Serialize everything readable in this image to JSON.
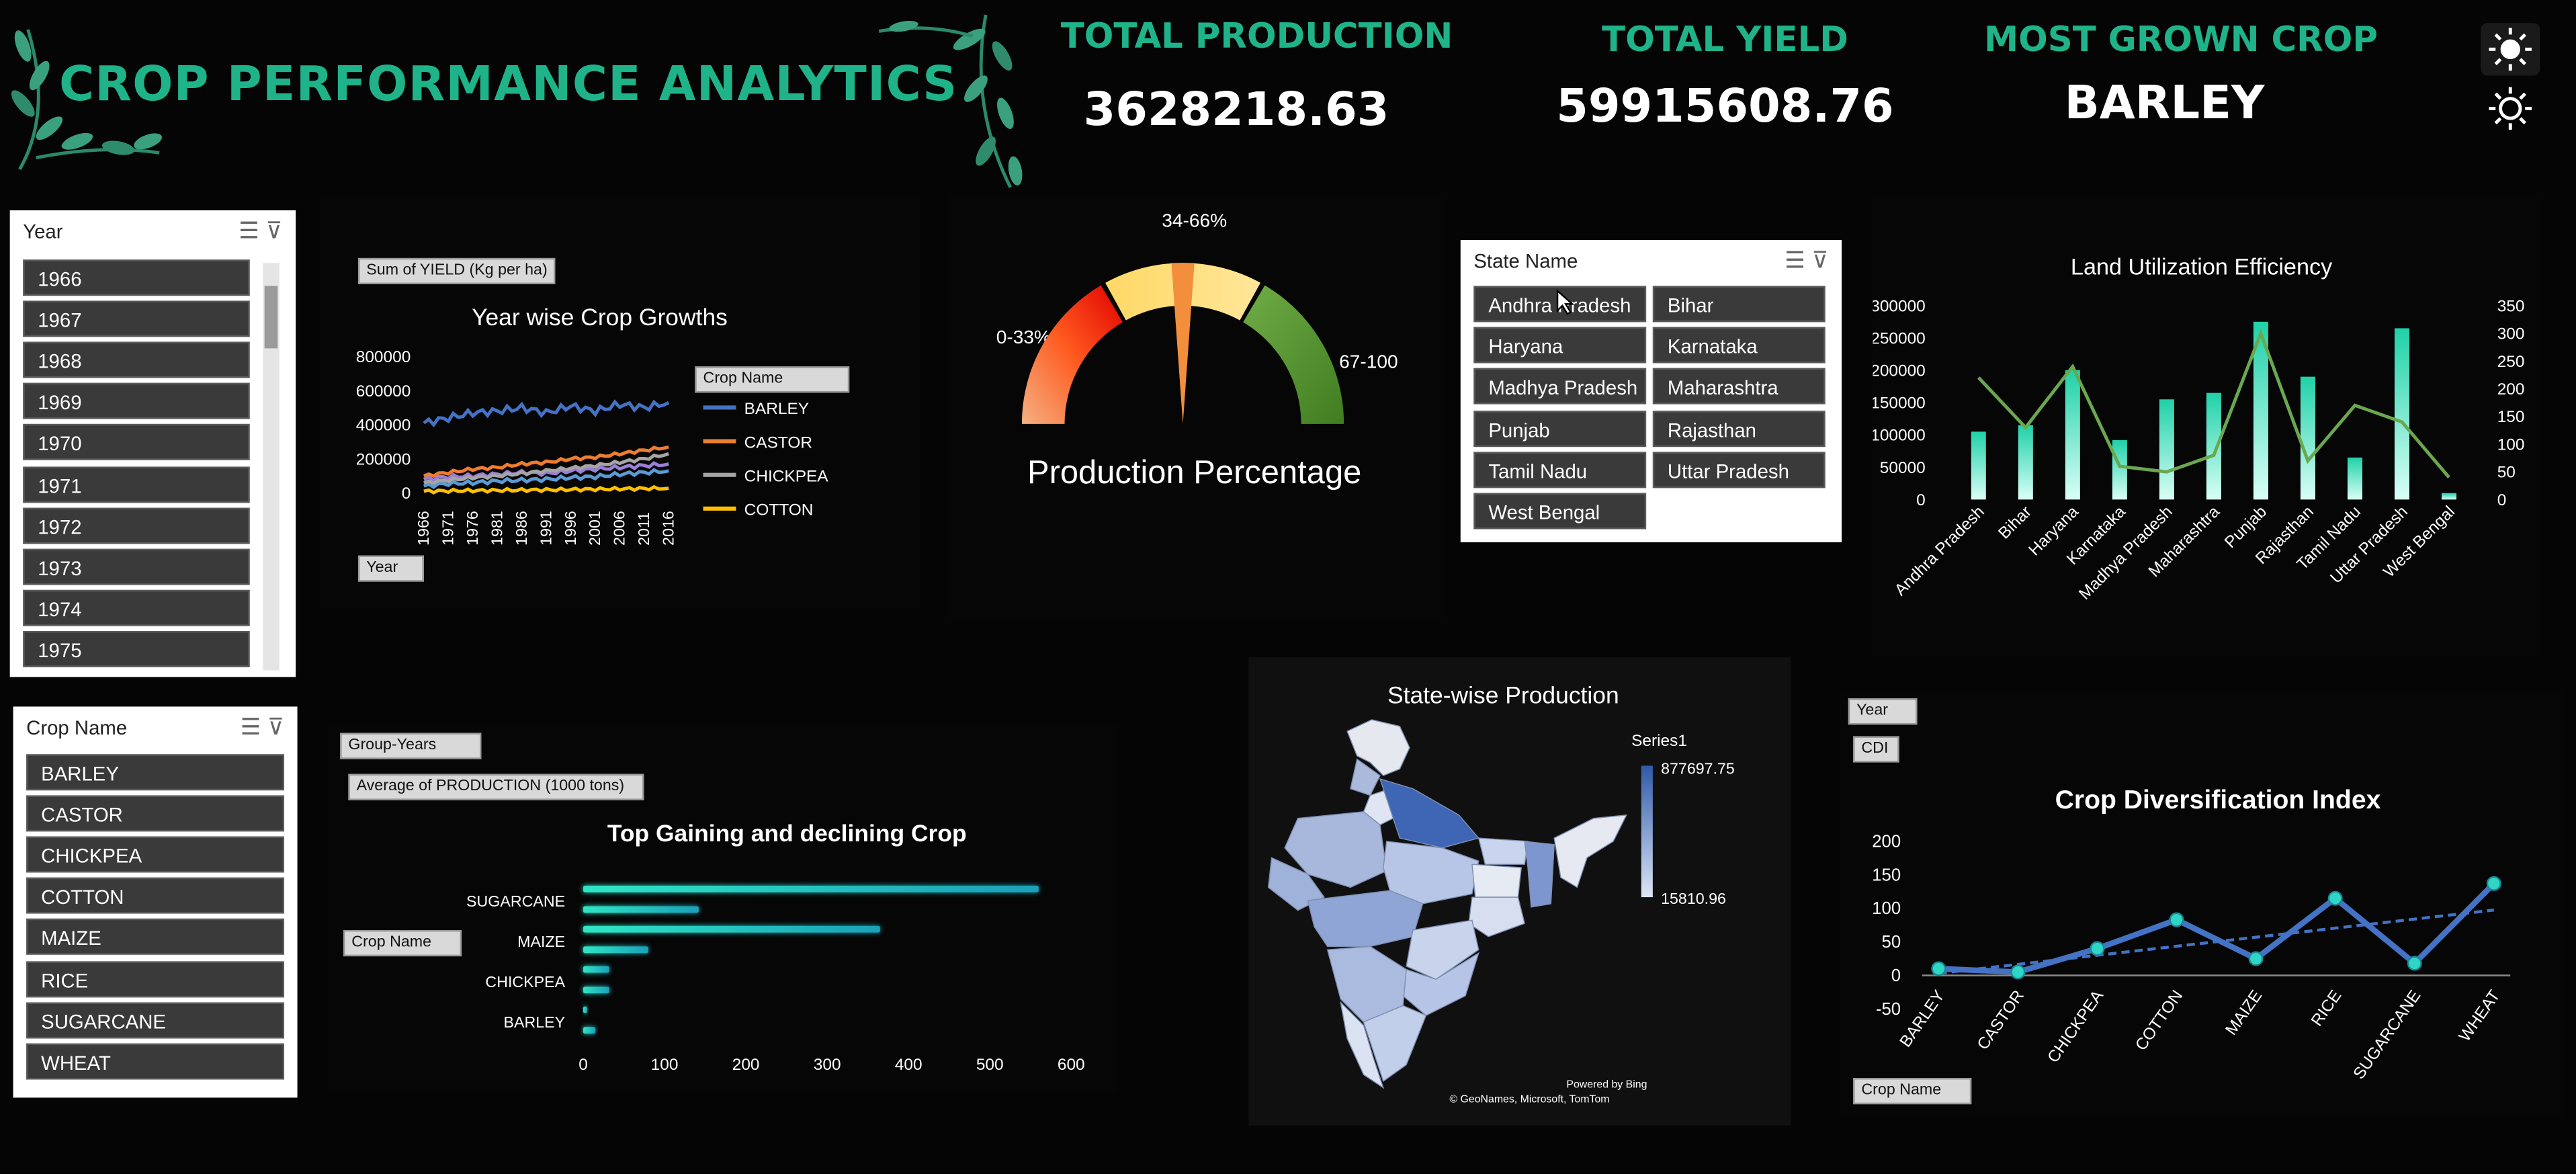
{
  "header": {
    "title": "CROP PERFORMANCE ANALYTICS",
    "kpis": [
      {
        "label": "TOTAL PRODUCTION",
        "value": "3628218.63"
      },
      {
        "label": "TOTAL YIELD",
        "value": "59915608.76"
      },
      {
        "label": "MOST GROWN CROP",
        "value": "BARLEY"
      }
    ]
  },
  "year_slicer": {
    "title": "Year",
    "items": [
      "1966",
      "1967",
      "1968",
      "1969",
      "1970",
      "1971",
      "1972",
      "1973",
      "1974",
      "1975"
    ]
  },
  "crop_slicer": {
    "title": "Crop Name",
    "items": [
      "BARLEY",
      "CASTOR",
      "CHICKPEA",
      "COTTON",
      "MAIZE",
      "RICE",
      "SUGARCANE",
      "WHEAT"
    ]
  },
  "state_slicer": {
    "title": "State Name",
    "items": [
      "Andhra Pradesh",
      "Bihar",
      "Haryana",
      "Karnataka",
      "Madhya Pradesh",
      "Maharashtra",
      "Punjab",
      "Rajasthan",
      "Tamil Nadu",
      "Uttar Pradesh",
      "West Bengal"
    ]
  },
  "pivot_buttons": {
    "yield_field": "Sum of YIELD (Kg per ha)",
    "crop_name": "Crop Name",
    "year": "Year",
    "group_years": "Group-Years",
    "avg_production": "Average of PRODUCTION (1000 tons)",
    "crop_name2": "Crop Name",
    "year2": "Year",
    "cdi": "CDI",
    "crop_name3": "Crop Name"
  },
  "map": {
    "powered_by": "Powered by Bing",
    "attribution": "© GeoNames, Microsoft, TomTom"
  },
  "chart_data": [
    {
      "type": "line",
      "title": "Year wise  Crop Growths",
      "x": [
        1966,
        1971,
        1976,
        1981,
        1986,
        1991,
        1996,
        2001,
        2006,
        2011,
        2016
      ],
      "ylim": [
        0,
        800000
      ],
      "yticks": [
        "800000",
        "600000",
        "400000",
        "200000",
        "0"
      ],
      "xticks": [
        "1966",
        "1971",
        "1976",
        "1981",
        "1986",
        "1991",
        "1996",
        "2001",
        "2006",
        "2011",
        "2016"
      ],
      "legend_title": "Crop Name",
      "series": [
        {
          "name": "BARLEY",
          "color": "#4472c4",
          "values": [
            410000,
            440000,
            470000,
            480000,
            500000,
            470000,
            510000,
            480000,
            520000,
            500000,
            530000
          ]
        },
        {
          "name": "CASTOR",
          "color": "#ed7d31",
          "values": [
            100000,
            120000,
            140000,
            150000,
            170000,
            180000,
            200000,
            210000,
            230000,
            250000,
            270000
          ]
        },
        {
          "name": "CHICKPEA",
          "color": "#a5a5a5",
          "values": [
            60000,
            75000,
            90000,
            100000,
            115000,
            130000,
            145000,
            160000,
            180000,
            200000,
            230000
          ]
        },
        {
          "name": "COTTON",
          "color": "#ffc000",
          "values": [
            10000,
            12000,
            14000,
            15000,
            17000,
            18000,
            20000,
            22000,
            24000,
            26000,
            28000
          ]
        }
      ],
      "extra_lines": [
        {
          "color": "#9a7fd4",
          "values": [
            80000,
            95000,
            100000,
            110000,
            120000,
            115000,
            130000,
            140000,
            150000,
            160000,
            170000
          ]
        },
        {
          "color": "#5b9bd5",
          "values": [
            40000,
            55000,
            60000,
            70000,
            75000,
            80000,
            90000,
            95000,
            110000,
            120000,
            130000
          ]
        }
      ]
    },
    {
      "type": "gauge",
      "title": "Production Percentage",
      "bands": [
        {
          "label": "0-33%",
          "from": 0,
          "to": 33
        },
        {
          "label": "34-66%",
          "from": 34,
          "to": 66
        },
        {
          "label": "67-100",
          "from": 67,
          "to": 100
        }
      ],
      "needle_value": 50
    },
    {
      "type": "bar",
      "title": "Land Utilization Efficiency",
      "categories": [
        "Andhra Pradesh",
        "Bihar",
        "Haryana",
        "Karnataka",
        "Madhya Pradesh",
        "Maharashtra",
        "Punjab",
        "Rajasthan",
        "Tamil Nadu",
        "Uttar Pradesh",
        "West Bengal"
      ],
      "ylim": [
        0,
        300000
      ],
      "yticks": [
        "300000",
        "250000",
        "200000",
        "150000",
        "100000",
        "50000",
        "0"
      ],
      "y2lim": [
        0,
        350
      ],
      "y2ticks": [
        "350",
        "300",
        "250",
        "200",
        "150",
        "100",
        "50",
        "0"
      ],
      "bar_values": [
        105000,
        115000,
        200000,
        92000,
        155000,
        165000,
        275000,
        190000,
        65000,
        265000,
        10000
      ],
      "line_values": [
        220,
        130,
        240,
        60,
        50,
        80,
        300,
        70,
        170,
        140,
        40
      ]
    },
    {
      "type": "bar",
      "title": "Top Gaining and declining Crop",
      "categories": [
        "SUGARCANE",
        "MAIZE",
        "CHICKPEA",
        "BARLEY"
      ],
      "xlim": [
        0,
        600
      ],
      "xticks": [
        "0",
        "100",
        "200",
        "300",
        "400",
        "500",
        "600"
      ],
      "bars": [
        560,
        142,
        365,
        80,
        32,
        32,
        5,
        15
      ]
    },
    {
      "type": "map",
      "title": "State-wise Production",
      "legend_series": "Series1",
      "legend_max": "877697.75",
      "legend_min": "15810.96"
    },
    {
      "type": "line",
      "title": "Crop Diversification Index",
      "categories": [
        "BARLEY",
        "CASTOR",
        "CHICKPEA",
        "COTTON",
        "MAIZE",
        "RICE",
        "SUGARCANE",
        "WHEAT"
      ],
      "ylim": [
        -50,
        200
      ],
      "yticks": [
        "200",
        "150",
        "100",
        "50",
        "0",
        "-50"
      ],
      "values": [
        10,
        5,
        40,
        83,
        25,
        115,
        18,
        137
      ],
      "trend": [
        3,
        138
      ]
    }
  ]
}
